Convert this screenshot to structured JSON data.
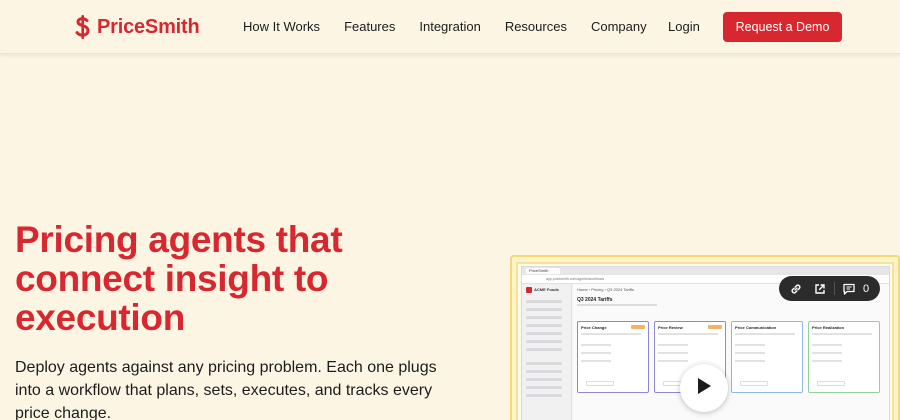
{
  "brand": {
    "name": "PriceSmith",
    "color": "#d7282f",
    "logo_icon": "dollar-s-icon"
  },
  "nav": {
    "links": [
      "How It Works",
      "Features",
      "Integration",
      "Resources",
      "Company"
    ],
    "login": "Login",
    "cta": "Request a Demo"
  },
  "hero": {
    "headline": "Pricing agents that connect insight to execution",
    "subheadline": "Deploy agents against any pricing problem. Each one plugs into a workflow that plans, sets, executes, and tracks every price change."
  },
  "video": {
    "toolbar": {
      "link_icon": "link-icon",
      "open_icon": "external-link-icon",
      "comment_icon": "comment-icon",
      "comment_count": "0"
    },
    "play_icon": "play-icon",
    "preview": {
      "tab_label": "PriceSmith",
      "url": "app.pricesmith.com/agents/workflows",
      "app_name": "ACME Foods",
      "breadcrumb": "Home › Pricing › Q3 2024 Tariffs",
      "page_title": "Q3 2024 Tariffs",
      "cards": [
        "Price Change",
        "Price Review",
        "Price Communication",
        "Price Realization"
      ]
    }
  }
}
